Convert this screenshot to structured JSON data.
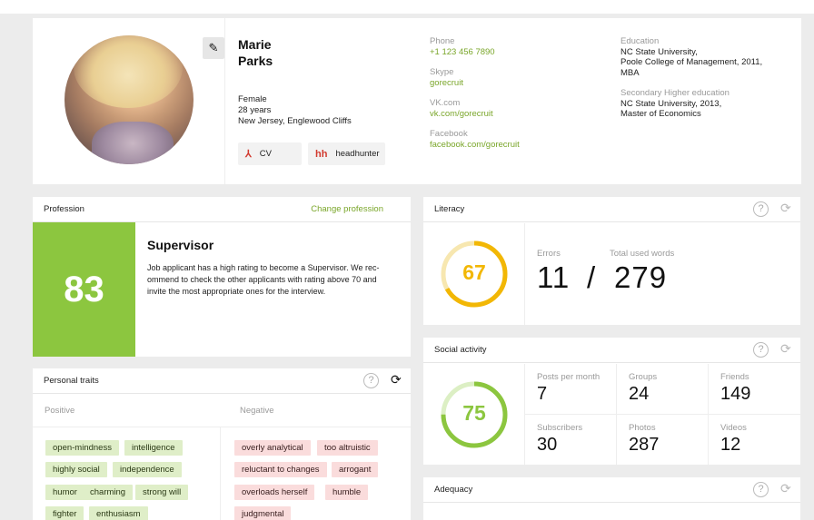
{
  "profile": {
    "first_name": "Marie",
    "last_name": "Parks",
    "gender": "Female",
    "age": "28 years",
    "location": "New Jersey, Englewood Cliffs",
    "cv_label": "CV",
    "hh_icon": "hh",
    "headhunter_label": "headhunter"
  },
  "contacts": {
    "phone_label": "Phone",
    "phone": "+1 123 456 7890",
    "skype_label": "Skype",
    "skype": "gorecruit",
    "vk_label": "VK.com",
    "vk": "vk.com/gorecruit",
    "facebook_label": "Facebook",
    "facebook": "facebook.com/gorecruit"
  },
  "education": {
    "label": "Education",
    "line1": "NC State University,",
    "line2": "Poole College of Management, 2011,",
    "line3": "MBA",
    "secondary_label": "Secondary Higher education",
    "secondary_line1": "NC State University, 2013,",
    "secondary_line2": "Master of Economics"
  },
  "profession": {
    "header": "Profession",
    "change_link": "Change profession",
    "score": "83",
    "title": "Supervisor",
    "description": "Job applicant has a high rating to become a Supervisor. We rec-ommend to check the other applicants with rating above 70 and invite the most appropriate ones for the interview."
  },
  "traits": {
    "header": "Personal traits",
    "positive_label": "Positive",
    "negative_label": "Negative",
    "positive": [
      "open-mindness",
      "intelligence",
      "highly social",
      "independence",
      "humor",
      "charming",
      "strong will",
      "fighter",
      "enthusiasm"
    ],
    "negative": [
      "overly analytical",
      "too altruistic",
      "reluctant to changes",
      "arrogant",
      "overloads herself",
      "humble",
      "judgmental"
    ]
  },
  "literacy": {
    "header": "Literacy",
    "score": "67",
    "score_fraction": 0.67,
    "errors_label": "Errors",
    "errors": "11",
    "separator": "/",
    "words_label": "Total used words",
    "words": "279",
    "color": "#f2b705"
  },
  "social": {
    "header": "Social activity",
    "score": "75",
    "score_fraction": 0.75,
    "color": "#8cc63f",
    "posts_label": "Posts per month",
    "posts": "7",
    "groups_label": "Groups",
    "groups": "24",
    "friends_label": "Friends",
    "friends": "149",
    "subscribers_label": "Subscribers",
    "subscribers": "30",
    "photos_label": "Photos",
    "photos": "287",
    "videos_label": "Videos",
    "videos": "12"
  },
  "adequacy": {
    "header": "Adequacy"
  },
  "icons": {
    "help": "?",
    "sync": "⟳",
    "edit": "✎",
    "pdf": "⅄"
  }
}
